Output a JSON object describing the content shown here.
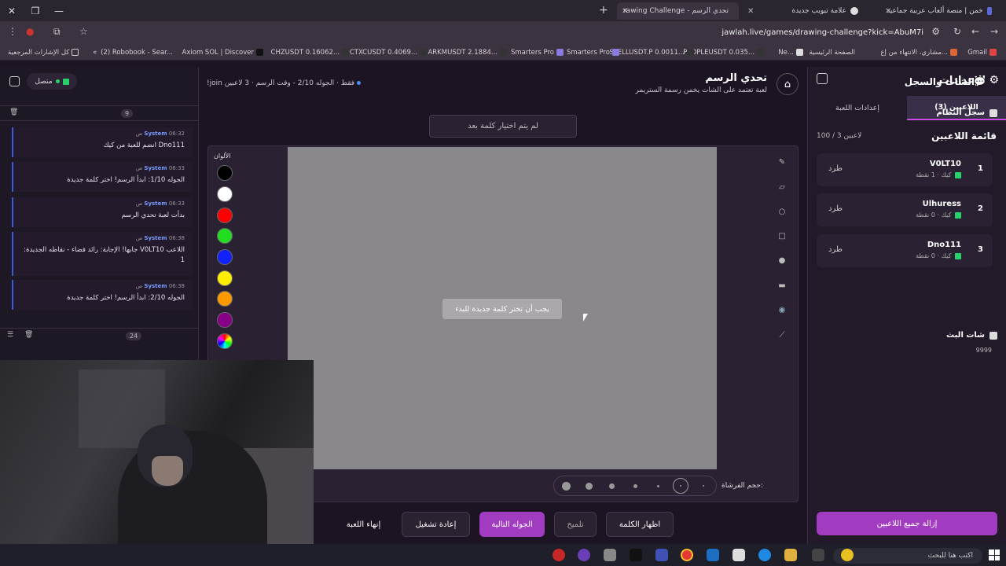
{
  "browser": {
    "tabs": [
      {
        "title": "خمن | منصة ألعاب عربية جماعية",
        "close": "✕"
      },
      {
        "title": "علامة تبويب جديدة",
        "close": "✕"
      },
      {
        "title": "rawing Challenge - تحدي الرسم",
        "close": "✕"
      }
    ],
    "new_tab": "+",
    "url": "jawlah.live/games/drawing-challenge?kick=AbuM7i",
    "bookmarks": [
      {
        "label": "Gmail"
      },
      {
        "label": "مشاري، الانتهاء من إع..."
      },
      {
        "label": "الصفحة الرئيسية"
      },
      {
        "label": "Ne..."
      },
      {
        "label": "PEOPLEUSDT 0.035..."
      },
      {
        "label": "SPELLUSDT.P 0.0011..."
      },
      {
        "label": "Smarters Pro"
      },
      {
        "label": "Smarters Pro"
      },
      {
        "label": "ARKMUSDT 2.1884..."
      },
      {
        "label": "CTXCUSDT 0.4069..."
      },
      {
        "label": "CHZUSDT 0.16062..."
      },
      {
        "label": "Axiom SOL | Discover"
      },
      {
        "label": "(2) Robobook - Sear..."
      },
      {
        "label": "كل الإشارات المرجعية"
      }
    ],
    "bookmark_more": "«"
  },
  "settings": {
    "title": "الإعدادات",
    "tabs": [
      {
        "label": "اللاعبين (3)",
        "active": true
      },
      {
        "label": "إعدادات اللعبة",
        "active": false
      }
    ],
    "list_title": "قائمة اللاعبين",
    "list_count": "100 / 3 لاعبين",
    "players": [
      {
        "rank": "1",
        "name": "V0LT10",
        "sub": "كيك · 1 نقطة",
        "kick": "طرد"
      },
      {
        "rank": "2",
        "name": "Ulhuress",
        "sub": "كيك · 0 نقطة",
        "kick": "طرد"
      },
      {
        "rank": "3",
        "name": "Dno111",
        "sub": "كيك · 0 نقطة",
        "kick": "طرد"
      }
    ],
    "remove_all": "إزالة جميع اللاعبين"
  },
  "chat": {
    "title": "الشات والسجل",
    "status": "متصل",
    "system_log": {
      "title": "سجل النظام",
      "count": "9"
    },
    "messages": [
      {
        "sender": "System",
        "time": "06:32 ص",
        "text": "Dno111 انضم للعبة من كيك"
      },
      {
        "sender": "System",
        "time": "06:33 ص",
        "text": "الجوله 1/10: ابدأ الرسم! اختر كلمة جديدة"
      },
      {
        "sender": "System",
        "time": "06:33 ص",
        "text": "بدأت لعبة تحدي الرسم"
      },
      {
        "sender": "System",
        "time": "06:38 ص",
        "text": "اللاعب V0LT10 جابها! الإجابة: رائد فضاء - نقاطه الجديدة: 1"
      },
      {
        "sender": "System",
        "time": "06:38 ص",
        "text": "الجوله 2/10: ابدأ الرسم! اختر كلمة جديدة"
      }
    ],
    "stream_chat": {
      "title": "شات البث",
      "count": "24",
      "preview": "9999"
    }
  },
  "game": {
    "title": "تحدي الرسم",
    "subtitle": "لعبة تعتمد على الشات يخمن رسمة الستريمر",
    "players_info": "3 لاعبين",
    "round_info": "الجوله 2/10 - وقت الرسم",
    "join_info": "!join فقط",
    "word_status": "لم يتم اختيار كلمة بعد",
    "colors_title": "الألوان",
    "colors": [
      "#000000",
      "#ffffff",
      "#ff0000",
      "#22dd22",
      "#1020ff",
      "#ffee00",
      "#ff9900",
      "#880088"
    ],
    "board_message": "يجب أن تختر كلمة جديدة للبدء",
    "brush_label": "حجم الفرشاة:",
    "tools": [
      "pencil-icon",
      "eraser-icon",
      "circle-icon",
      "rectangle-icon",
      "fill-dot-icon",
      "line-icon",
      "fill-bucket-icon",
      "line-tool-icon"
    ],
    "buttons": {
      "show_word": "اظهار الكلمة",
      "hint": "تلميح",
      "next_round": "الجوله التالية",
      "restart": "إعادة تشغيل",
      "end_game": "إنهاء اللعبة"
    }
  },
  "taskbar": {
    "search_placeholder": "اكتب هنا للبحث"
  }
}
